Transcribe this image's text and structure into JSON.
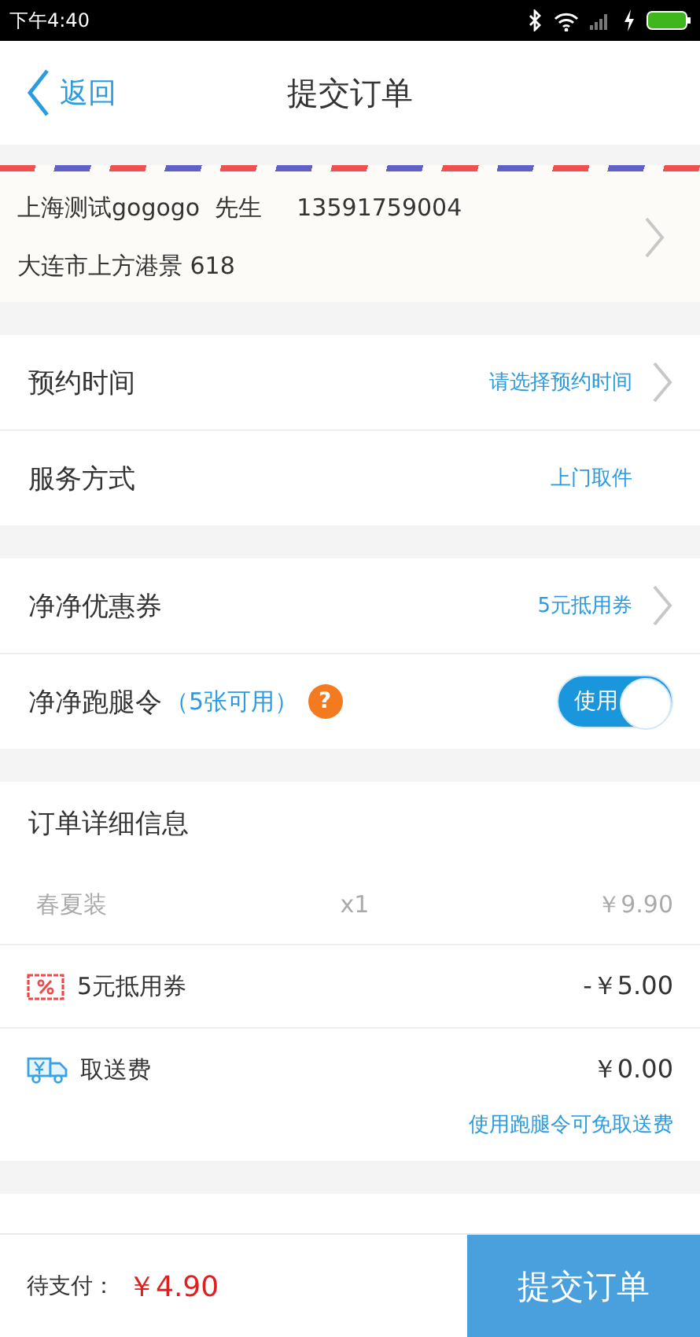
{
  "status_bar": {
    "time": "下午4:40"
  },
  "header": {
    "back": "返回",
    "title": "提交订单"
  },
  "address": {
    "name": "上海测试gogogo  先生",
    "phone": "13591759004",
    "address": "大连市上方港景 618"
  },
  "service": [
    {
      "label": "预约时间",
      "value": "请选择预约时间",
      "chevron": true
    },
    {
      "label": "服务方式",
      "value": "上门取件",
      "chevron": false
    }
  ],
  "discounts": {
    "coupon": {
      "label": "净净优惠券",
      "value": "5元抵用券"
    },
    "errand": {
      "label": "净净跑腿令",
      "count": "（5张可用）",
      "help": "?",
      "switch_label": "使用",
      "on": true
    }
  },
  "order_details": {
    "title": "订单详细信息",
    "items": [
      {
        "name": "春夏装",
        "qty": "x1",
        "price": "￥9.90"
      }
    ],
    "lines": [
      {
        "kind": "coupon",
        "label": "5元抵用券",
        "amount": "-￥5.00"
      },
      {
        "kind": "delivery",
        "label": "取送费",
        "amount": "￥0.00"
      }
    ],
    "note": "使用跑腿令可免取送费"
  },
  "footer": {
    "label": "待支付：",
    "total": "￥4.90",
    "submit": "提交订单"
  }
}
